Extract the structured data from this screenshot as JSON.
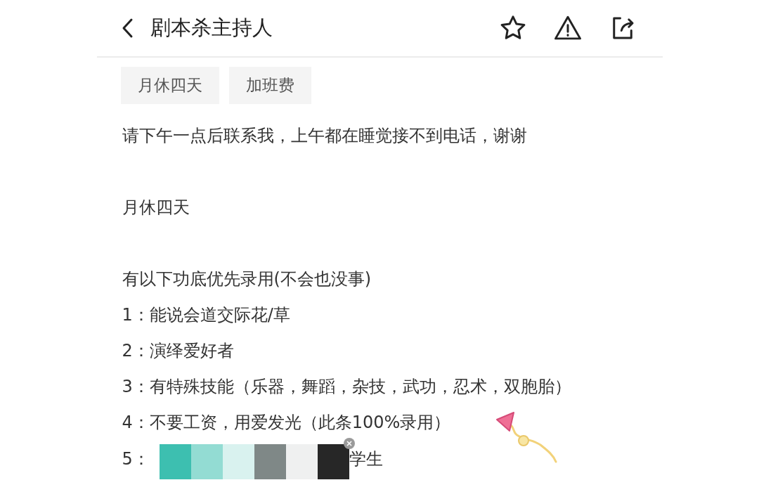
{
  "header": {
    "title": "剧本杀主持人"
  },
  "tags": [
    {
      "label": "月休四天"
    },
    {
      "label": "加班费"
    }
  ],
  "paragraphs": [
    {
      "lines": [
        "请下午一点后联系我，上午都在睡觉接不到电话，谢谢"
      ]
    },
    {
      "lines": [
        "月休四天"
      ]
    },
    {
      "lines": [
        "有以下功底优先录用(不会也没事)",
        "1：能说会道交际花/草",
        "2：演绎爱好者",
        "3：有特殊技能（乐器，舞蹈，杂技，武功，忍术，双胞胎）",
        "4：不要工资，用爱发光（此条100%录用）"
      ]
    }
  ],
  "covered_line": {
    "prefix": "5：",
    "visible_text": "学生",
    "swatches": [
      {
        "color": "#3dbfb0"
      },
      {
        "color": "#93dcd3"
      },
      {
        "color": "#d9f2ef"
      },
      {
        "color": "#7f8887"
      },
      {
        "color": "#eff0f0"
      },
      {
        "color": "#272727"
      }
    ]
  }
}
